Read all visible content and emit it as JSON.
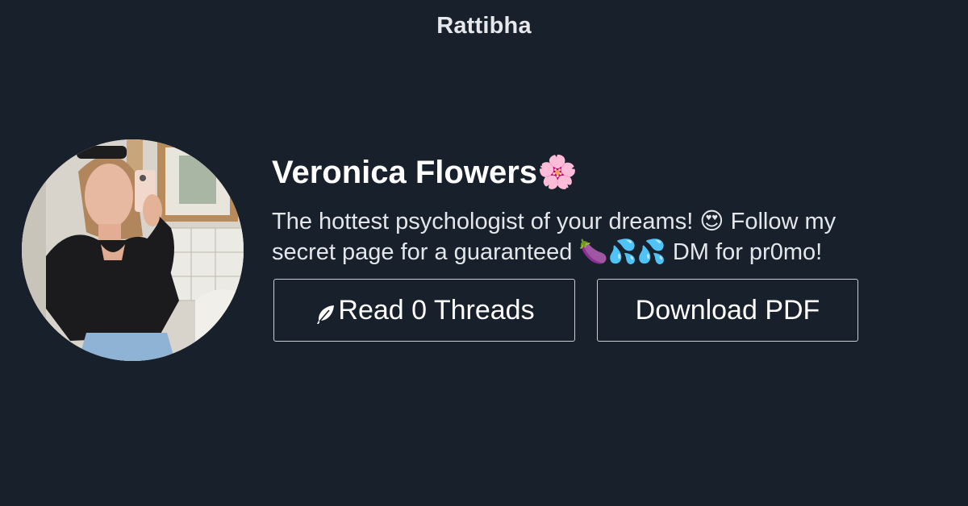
{
  "site": {
    "brand": "Rattibha"
  },
  "profile": {
    "display_name": "Veronica Flowers🌸",
    "bio_line1": "The hottest psychologist of your dreams! 😍 Follow my",
    "bio_line2": "secret page for a guaranteed 🍆💦💦 DM for pr0mo!",
    "avatar_icon": "profile-photo"
  },
  "actions": {
    "read_label": "Read 0 Threads",
    "read_icon": "feather-icon",
    "pdf_label": "Download PDF"
  },
  "colors": {
    "background": "#17202b",
    "text": "#ffffff",
    "button_border": "#c9ced4"
  }
}
